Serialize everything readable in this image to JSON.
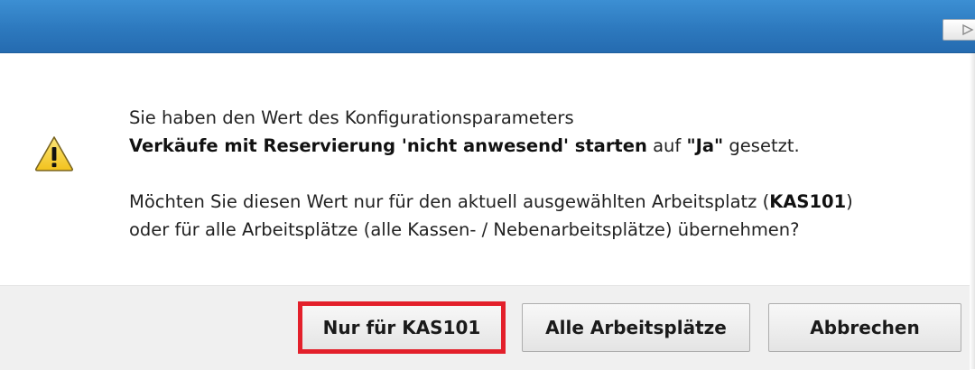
{
  "dialog": {
    "message": {
      "line1": "Sie haben den Wert des Konfigurationsparameters",
      "param_name": "Verkäufe mit Reservierung 'nicht anwesend' starten",
      "on_word": "auf",
      "value": "\"Ja\"",
      "set_word": "gesetzt.",
      "question_pre": "Möchten Sie diesen Wert nur für den aktuell ausgewählten Arbeitsplatz (",
      "workstation": "KAS101",
      "question_close": ")",
      "question_line2": "oder für alle Arbeitsplätze (alle Kassen- / Nebenarbeitsplätze) übernehmen?"
    },
    "buttons": {
      "only_workstation": "Nur für KAS101",
      "all_workstations": "Alle Arbeitsplätze",
      "cancel": "Abbrechen"
    },
    "icons": {
      "warning": "warning-icon",
      "titlebar_button": "titlebar-button-icon"
    },
    "colors": {
      "titlebar": "#2d79be",
      "highlight": "#e3202b",
      "warning_fill": "#f7d64a"
    }
  }
}
